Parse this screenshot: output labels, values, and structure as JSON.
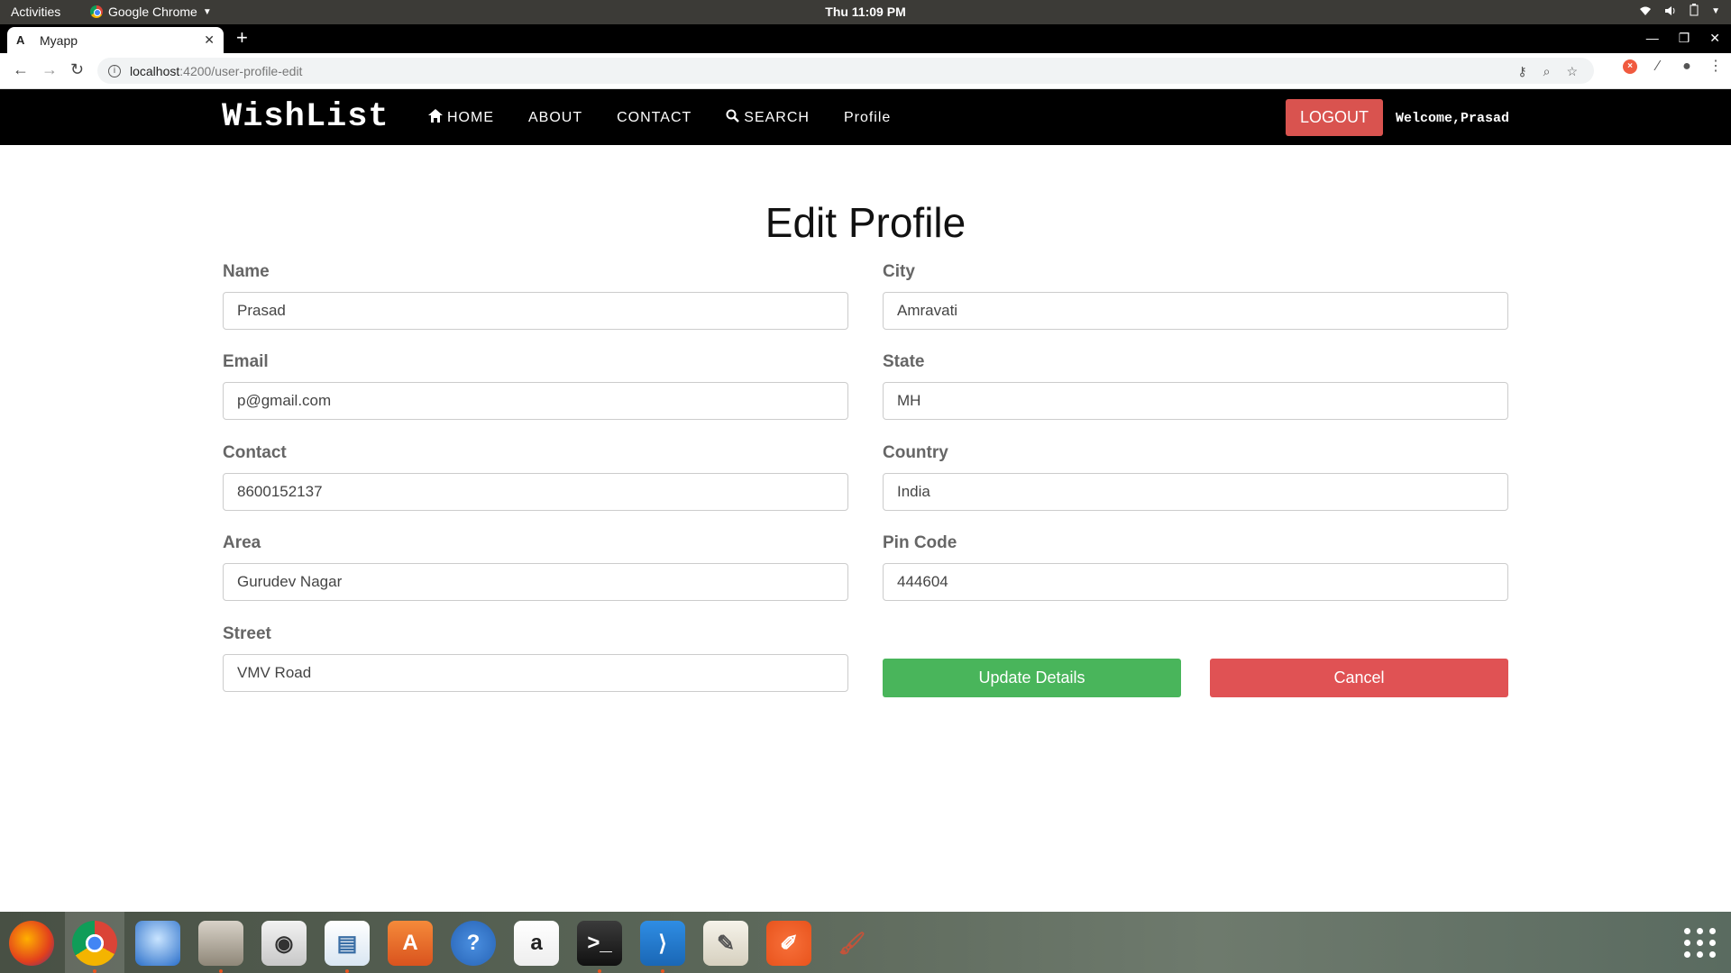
{
  "system_bar": {
    "activities": "Activities",
    "app_name": "Google Chrome",
    "clock": "Thu 11:09 PM"
  },
  "browser": {
    "tab_favicon": "A",
    "tab_title": "Myapp",
    "url_host": "localhost",
    "url_path": ":4200/user-profile-edit"
  },
  "navbar": {
    "brand": "WishList",
    "links": [
      "HOME",
      "ABOUT",
      "CONTACT",
      "SEARCH",
      "Profile"
    ],
    "logout": "LOGOUT",
    "welcome": "Welcome,Prasad"
  },
  "form": {
    "title": "Edit Profile",
    "name": {
      "label": "Name",
      "value": "Prasad"
    },
    "email": {
      "label": "Email",
      "value": "p@gmail.com"
    },
    "contact": {
      "label": "Contact",
      "value": "8600152137"
    },
    "area": {
      "label": "Area",
      "value": "Gurudev Nagar"
    },
    "street": {
      "label": "Street",
      "value": "VMV Road"
    },
    "city": {
      "label": "City",
      "value": "Amravati"
    },
    "state": {
      "label": "State",
      "value": "MH"
    },
    "country": {
      "label": "Country",
      "value": "India"
    },
    "pincode": {
      "label": "Pin Code",
      "value": "444604"
    },
    "update_label": "Update Details",
    "cancel_label": "Cancel"
  },
  "dock": {
    "apps": [
      "firefox-icon",
      "chrome-icon",
      "thunderbird-icon",
      "files-icon",
      "rhythmbox-icon",
      "libreoffice-writer-icon",
      "software-center-icon",
      "help-icon",
      "amazon-icon",
      "terminal-icon",
      "vscode-icon",
      "text-editor-icon",
      "postman-icon",
      "paint-icon"
    ]
  },
  "colors": {
    "navbar_bg": "#000000",
    "logout_bg": "#d9534f",
    "update_bg": "#49b55b",
    "cancel_bg": "#e05254"
  }
}
